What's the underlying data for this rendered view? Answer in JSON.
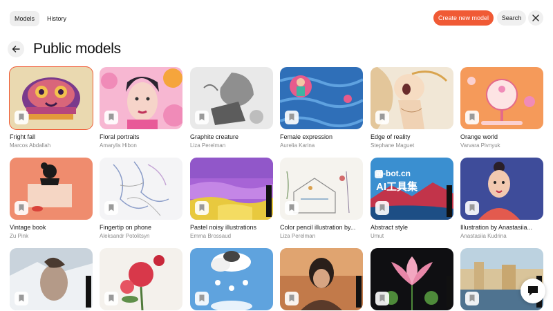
{
  "header": {
    "tabs": [
      {
        "label": "Models",
        "active": true
      },
      {
        "label": "History",
        "active": false
      }
    ],
    "create_label": "Create new model",
    "search_label": "Search",
    "accent_color": "#f05a35"
  },
  "page": {
    "title": "Public models"
  },
  "cards": [
    {
      "title": "Fright fall",
      "author": "Marcos Abdallah",
      "selected": true
    },
    {
      "title": "Floral portraits",
      "author": "Amarylis Hibon"
    },
    {
      "title": "Graphite creature",
      "author": "Liza Perelman"
    },
    {
      "title": "Female expression",
      "author": "Aurelia Karina"
    },
    {
      "title": "Edge of reality",
      "author": "Stephane Maguet"
    },
    {
      "title": "Orange world",
      "author": "Varvara Pivnyuk"
    },
    {
      "title": "Vintage book",
      "author": "Zu Pink"
    },
    {
      "title": "Fingertip on phone",
      "author": "Aleksandr Potolitsyn"
    },
    {
      "title": "Pastel noisy illustrations",
      "author": "Emma Brossaud"
    },
    {
      "title": "Color pencil illustration by...",
      "author": "Liza Perelman"
    },
    {
      "title": "Abstract style",
      "author": "Umut"
    },
    {
      "title": "Illustration by Anastasiia...",
      "author": "Anastasiia Kudrina"
    }
  ],
  "overlay_watermark": {
    "line1": "ai-bot.cn",
    "line2": "AI工具集"
  },
  "icons": {
    "back": "arrow-left-icon",
    "close": "close-icon",
    "bookmark": "bookmark-icon",
    "chat": "chat-bubble-icon"
  }
}
